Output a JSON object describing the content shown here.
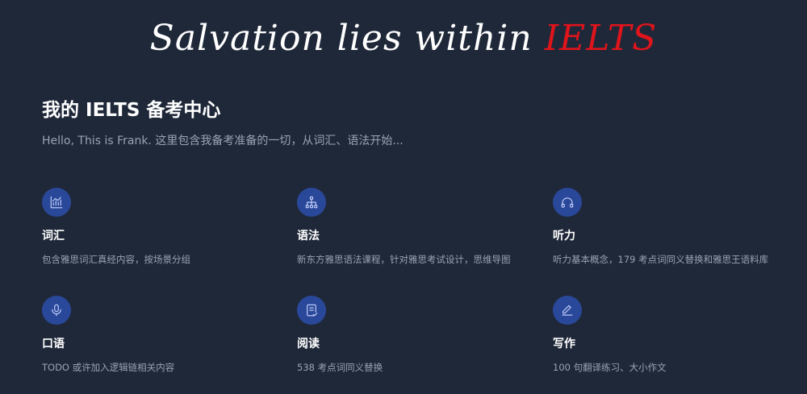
{
  "banner": {
    "text": "Salvation lies within ",
    "accent": "IELTS"
  },
  "header": {
    "title": "我的 IELTS 备考中心",
    "subtitle": "Hello, This is Frank. 这里包含我备考准备的一切，从词汇、语法开始..."
  },
  "colors": {
    "background": "#1f2839",
    "accent": "#e0141b",
    "icon_badge": "#2a4899",
    "muted_text": "#9aa3b2"
  },
  "features": [
    {
      "icon": "bar-chart-icon",
      "title": "词汇",
      "description": "包含雅思词汇真经内容，按场景分组"
    },
    {
      "icon": "sitemap-icon",
      "title": "语法",
      "description": "新东方雅思语法课程，针对雅思考试设计，思维导图"
    },
    {
      "icon": "headphones-icon",
      "title": "听力",
      "description": "听力基本概念，179 考点词同义替换和雅思王语料库"
    },
    {
      "icon": "microphone-icon",
      "title": "口语",
      "description": "TODO 或许加入逻辑链相关内容"
    },
    {
      "icon": "document-check-icon",
      "title": "阅读",
      "description": "538 考点词同义替换"
    },
    {
      "icon": "pencil-icon",
      "title": "写作",
      "description": "100 句翻译练习、大小作文"
    }
  ]
}
